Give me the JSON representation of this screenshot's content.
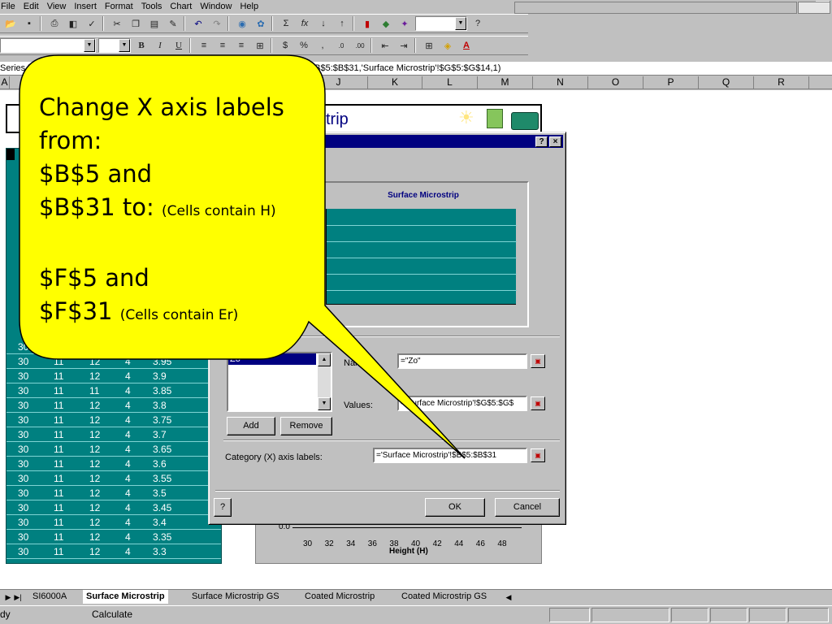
{
  "menu": {
    "items": [
      "File",
      "Edit",
      "View",
      "Insert",
      "Format",
      "Tools",
      "Chart",
      "Window",
      "Help"
    ]
  },
  "toolbar": {
    "standard_icons": [
      "new-icon",
      "save-icon",
      "print-icon",
      "print-preview-icon",
      "spelling-icon",
      "cut-icon",
      "copy-icon",
      "paste-icon",
      "format-painter-icon",
      "undo-icon",
      "redo-icon",
      "hyperlink-icon",
      "web-toolbar-icon",
      "autosum-icon",
      "paste-function-icon",
      "sort-ascending-icon",
      "sort-descending-icon",
      "chart-wizard-icon",
      "map-icon",
      "drawing-icon",
      "help-icon"
    ],
    "formatting_icons": [
      "bold-icon",
      "italic-icon",
      "underline-icon",
      "align-left-icon",
      "center-icon",
      "align-right-icon",
      "merge-center-icon",
      "currency-icon",
      "percent-icon",
      "comma-icon",
      "increase-decimal-icon",
      "decrease-decimal-icon",
      "decrease-indent-icon",
      "increase-indent-icon",
      "borders-icon",
      "fill-color-icon",
      "font-color-icon"
    ],
    "bold": "B",
    "italic": "I",
    "underline": "U",
    "percent": "%",
    "comma": ","
  },
  "formula_bar": {
    "name_box": "Series \"Z",
    "formula_tail": "!$B$5:$B$31,'Surface Microstrip'!$G$5:$G$14,1)"
  },
  "columns": [
    "A",
    "J",
    "K",
    "L",
    "M",
    "N",
    "O",
    "P",
    "Q",
    "R"
  ],
  "banner": {
    "title_fragment": "trip"
  },
  "table": {
    "rows": [
      [
        "30",
        "",
        "",
        "",
        ""
      ],
      [
        "30",
        "11",
        "12",
        "4",
        "3.95"
      ],
      [
        "30",
        "11",
        "12",
        "4",
        "3.9"
      ],
      [
        "30",
        "11",
        "11",
        "4",
        "3.85"
      ],
      [
        "30",
        "11",
        "12",
        "4",
        "3.8"
      ],
      [
        "30",
        "11",
        "12",
        "4",
        "3.75"
      ],
      [
        "30",
        "11",
        "12",
        "4",
        "3.7"
      ],
      [
        "30",
        "11",
        "12",
        "4",
        "3.65"
      ],
      [
        "30",
        "11",
        "12",
        "4",
        "3.6"
      ],
      [
        "30",
        "11",
        "12",
        "4",
        "3.55"
      ],
      [
        "30",
        "11",
        "12",
        "4",
        "3.5"
      ],
      [
        "30",
        "11",
        "12",
        "4",
        "3.45"
      ],
      [
        "30",
        "11",
        "12",
        "4",
        "3.4"
      ],
      [
        "30",
        "11",
        "12",
        "4",
        "3.35"
      ],
      [
        "30",
        "11",
        "12",
        "4",
        "3.3"
      ]
    ]
  },
  "chart": {
    "y_zero": "0.0",
    "x_ticks": [
      "30",
      "32",
      "34",
      "36",
      "38",
      "40",
      "42",
      "44",
      "46",
      "48"
    ],
    "x_label": "Height (H)"
  },
  "dialog": {
    "help_button": "?",
    "close_button": "×",
    "preview_title": "Surface Microstrip",
    "series_selected": "Zo",
    "name_label": "Name:",
    "name_value": "=\"Zo\"",
    "values_label": "Values:",
    "values_value": "='Surface Microstrip'!$G$5:$G$",
    "add_button": "Add",
    "remove_button": "Remove",
    "category_label": "Category (X) axis labels:",
    "category_value": "='Surface Microstrip'!$B$5:$B$31",
    "ok_button": "OK",
    "cancel_button": "Cancel"
  },
  "callout": {
    "line1": "Change X axis labels",
    "line2": "from:",
    "line3": "$B$5 and",
    "line4": "$B$31 to:",
    "note_h": "(Cells contain H)",
    "line5": "$F$5 and",
    "line6": "$F$31",
    "note_er": "(Cells contain Er)",
    "fill_color": "#ffff00"
  },
  "sheet_tabs": {
    "tabs": [
      "SI6000A",
      "Surface Microstrip",
      "Surface Microstrip GS",
      "Coated Microstrip",
      "Coated Microstrip GS"
    ],
    "active": "Surface Microstrip"
  },
  "status": {
    "ready": "dy",
    "calculate": "Calculate"
  },
  "colors": {
    "teal": "#008080",
    "dialog_title": "#000080",
    "callout": "#ffff00"
  }
}
